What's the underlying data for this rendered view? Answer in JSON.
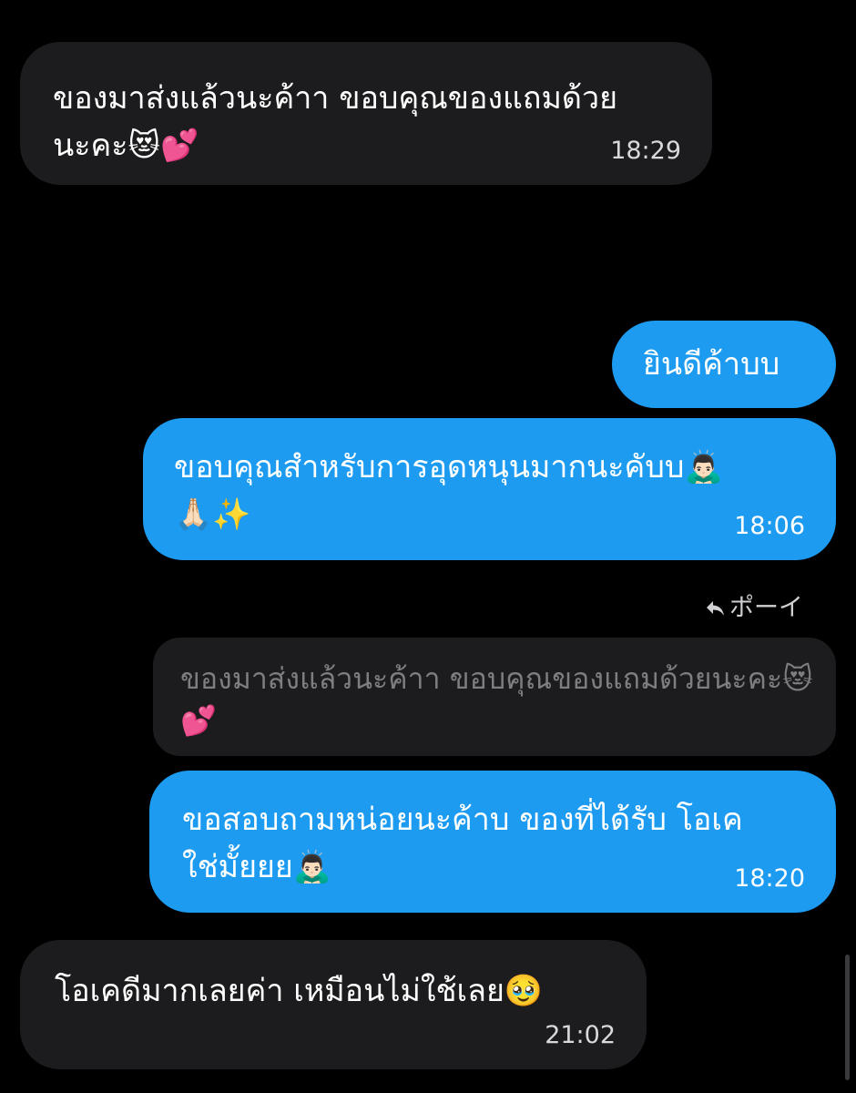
{
  "colors": {
    "background": "#000000",
    "incoming_bubble": "#1c1c1e",
    "outgoing_bubble": "#1d9bf0",
    "quoted_text": "#7d7d82"
  },
  "messages": [
    {
      "id": "m1",
      "direction": "incoming",
      "text": "ของมาส่งแล้วนะค้าา ขอบคุณของแถมด้วย\nนะคะ😻💕",
      "time": "18:29"
    },
    {
      "id": "m2",
      "direction": "outgoing",
      "text": "ยินดีค้าบบ",
      "time": ""
    },
    {
      "id": "m3",
      "direction": "outgoing",
      "text": "ขอบคุณสำหรับการอุดหนุนมากนะคับบ🙇🏻‍♂️\n🙏🏻✨",
      "time": "18:06"
    },
    {
      "id": "m4",
      "direction": "outgoing",
      "reply": {
        "icon": "reply-arrow-icon",
        "label": "ポーイ",
        "quoted_text": "ของมาส่งแล้วนะค้าา ขอบคุณของแถมด้วยนะคะ😻\n💕"
      },
      "text": "ขอสอบถามหน่อยนะค้าบ ของที่ได้รับ โอเค\nใช่มั้ยยย🙇🏻‍♂️",
      "time": "18:20"
    },
    {
      "id": "m5",
      "direction": "incoming",
      "text": "โอเคดีมากเลยค่า เหมือนไม่ใช้เลย🥹",
      "time": "21:02"
    }
  ]
}
